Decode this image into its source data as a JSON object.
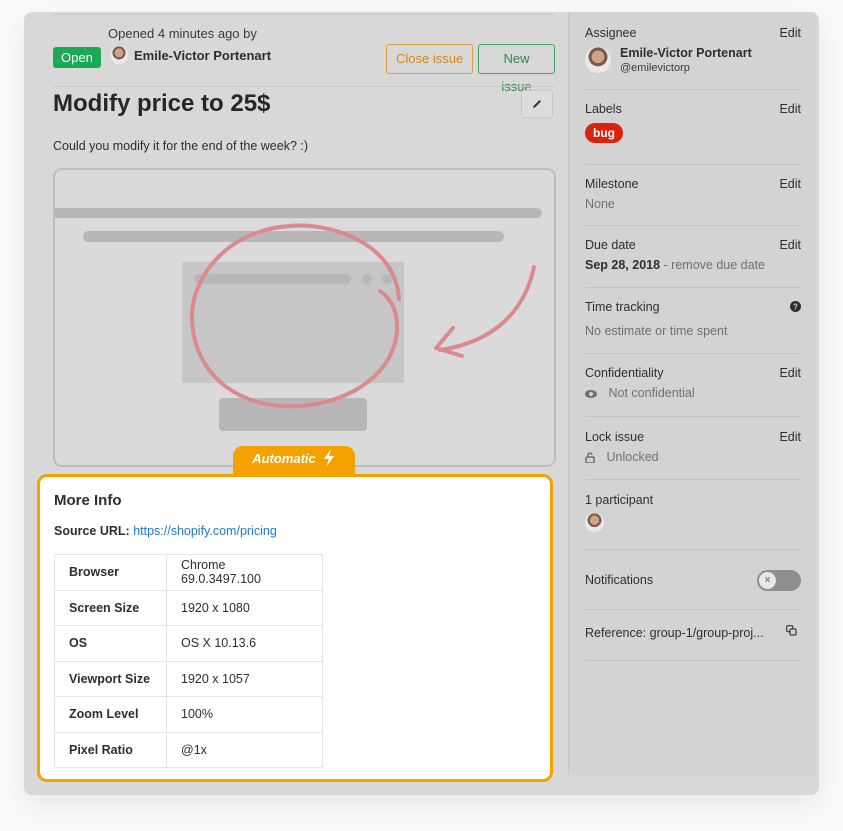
{
  "issue": {
    "status": "Open",
    "opened_text": "Opened 4 minutes ago by",
    "author": "Emile-Victor Portenart",
    "close_button": "Close issue",
    "new_button": "New issue",
    "title": "Modify price to 25$",
    "description": "Could you modify it for the end of the week? :)"
  },
  "automatic_tab": {
    "label": "Automatic",
    "icon": "lightning-bolt-icon"
  },
  "more_info": {
    "title": "More Info",
    "source_url_label": "Source URL:",
    "source_url": "https://shopify.com/pricing",
    "rows": [
      {
        "key": "Browser",
        "value": "Chrome 69.0.3497.100"
      },
      {
        "key": "Screen Size",
        "value": "1920 x 1080"
      },
      {
        "key": "OS",
        "value": "OS X 10.13.6"
      },
      {
        "key": "Viewport Size",
        "value": "1920 x 1057"
      },
      {
        "key": "Zoom Level",
        "value": "100%"
      },
      {
        "key": "Pixel Ratio",
        "value": "@1x"
      }
    ]
  },
  "sidebar": {
    "edit_label": "Edit",
    "assignee": {
      "label": "Assignee",
      "name": "Emile-Victor Portenart",
      "handle": "@emilevictorp"
    },
    "labels": {
      "label": "Labels",
      "items": [
        "bug"
      ],
      "bug_color": "#d9230f"
    },
    "milestone": {
      "label": "Milestone",
      "value": "None"
    },
    "due_date": {
      "label": "Due date",
      "value": "Sep 28, 2018",
      "remove": "- remove due date"
    },
    "time_tracking": {
      "label": "Time tracking",
      "value": "No estimate or time spent"
    },
    "confidentiality": {
      "label": "Confidentiality",
      "value": "Not confidential"
    },
    "lock_issue": {
      "label": "Lock issue",
      "value": "Unlocked"
    },
    "participants": {
      "label": "1 participant"
    },
    "notifications": {
      "label": "Notifications",
      "enabled": false
    },
    "reference": {
      "label": "Reference: group-1/group-proj..."
    }
  },
  "colors": {
    "open_green": "#1aaa55",
    "accent_orange": "#f5a200",
    "link_blue": "#1f78d1",
    "annotation_red": "#d98a8a"
  }
}
